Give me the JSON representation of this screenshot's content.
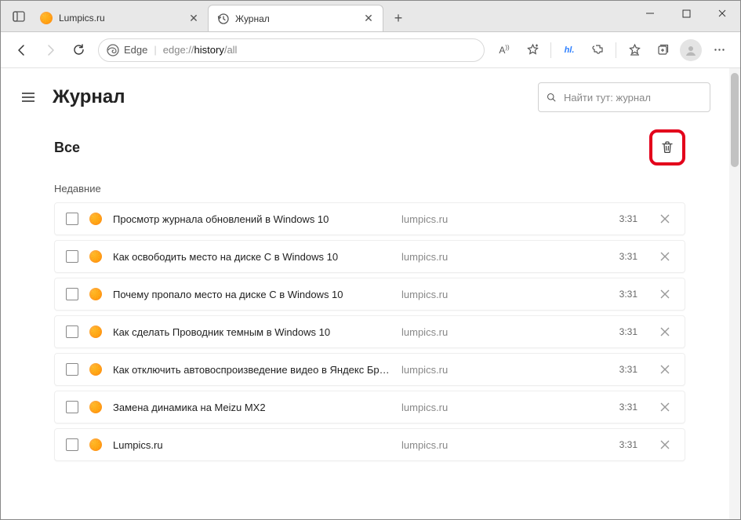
{
  "tabs": [
    {
      "title": "Lumpics.ru",
      "icon": "orange",
      "active": false
    },
    {
      "title": "Журнал",
      "icon": "history",
      "active": true
    }
  ],
  "toolbar": {
    "edge_label": "Edge",
    "url_prefix": "edge://",
    "url_seg1": "history",
    "url_seg2": "/all"
  },
  "page": {
    "title": "Журнал",
    "search_placeholder": "Найти тут: журнал",
    "section_title": "Все",
    "recent_label": "Недавние"
  },
  "history": [
    {
      "title": "Просмотр журнала обновлений в Windows 10",
      "domain": "lumpics.ru",
      "time": "3:31"
    },
    {
      "title": "Как освободить место на диске C в Windows 10",
      "domain": "lumpics.ru",
      "time": "3:31"
    },
    {
      "title": "Почему пропало место на диске C в Windows 10",
      "domain": "lumpics.ru",
      "time": "3:31"
    },
    {
      "title": "Как сделать Проводник темным в Windows 10",
      "domain": "lumpics.ru",
      "time": "3:31"
    },
    {
      "title": "Как отключить автовоспроизведение видео в Яндекс Брау...",
      "domain": "lumpics.ru",
      "time": "3:31"
    },
    {
      "title": "Замена динамика на Meizu MX2",
      "domain": "lumpics.ru",
      "time": "3:31"
    },
    {
      "title": "Lumpics.ru",
      "domain": "lumpics.ru",
      "time": "3:31"
    }
  ]
}
